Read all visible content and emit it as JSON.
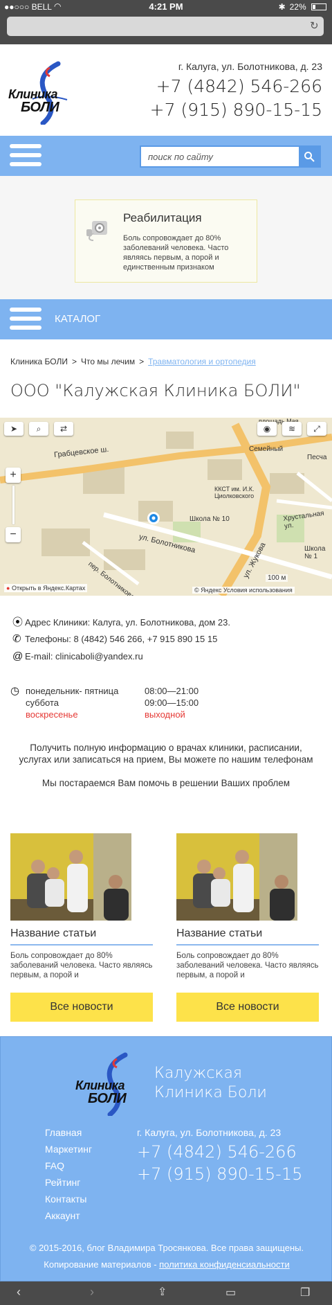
{
  "status_bar": {
    "carrier": "●●○○○ BELL",
    "time": "4:21 PM",
    "battery": "22%"
  },
  "header": {
    "logo_line1": "Клиника",
    "logo_line2": "БОЛИ",
    "address": "г. Калуга, ул. Болотникова, д. 23",
    "phone1": "+7 (4842) 546-266",
    "phone2": "+7 (915) 890-15-15"
  },
  "search": {
    "placeholder": "поиск по сайту"
  },
  "promo": {
    "title": "Реабилитация",
    "text": "Боль сопровождает до 80% заболеваний человека. Часто являясь первым, а порой и единственным признаком"
  },
  "catalog": {
    "label": "КАТАЛОГ"
  },
  "breadcrumb": {
    "items": [
      "Клиника БОЛИ",
      "Что мы лечим",
      "Травматология и ортопедия"
    ],
    "separator": ">"
  },
  "page_title": "ООО \"Калужская Клиника БОЛИ\"",
  "map": {
    "streets": [
      "Грабцевское ш.",
      "ул. Болотникова",
      "ул. Жукова",
      "пер. Болотникова",
      "Хрустальная ул.",
      "Песча",
      "площадь Мая"
    ],
    "pois": [
      "Семейный",
      "ККСТ им. И.К. Циолковского",
      "Школа № 10",
      "Школа № 1"
    ],
    "scale": "100 м",
    "open_link": "Открыть в Яндекс.Картах",
    "copyright": "© Яндекс Условия использования"
  },
  "contacts": {
    "address": "Адрес Клиники: Калуга, ул. Болотникова, дом 23.",
    "phones": "Телефоны: 8 (4842) 546 266, +7 915 890 15 15",
    "email": "E-mail: clinicaboli@yandex.ru"
  },
  "hours": [
    {
      "days": "понедельник- пятница",
      "time": "08:00—21:00"
    },
    {
      "days": "суббота",
      "time": "09:00—15:00"
    },
    {
      "days": "воскресенье",
      "time": "выходной"
    }
  ],
  "info_text": "Получить полную информацию о врачах клиники, расписании, услугах или записаться на прием, Вы можете по нашим телефонам",
  "help_text": "Мы постараемся Вам помочь в решении Ваших проблем",
  "articles": [
    {
      "title": "Название статьи",
      "text": "Боль сопровождает до 80% заболеваний человека. Часто являясь первым, а порой и",
      "button": "Все новости"
    },
    {
      "title": "Название статьи",
      "text": "Боль сопровождает до 80% заболеваний человека. Часто являясь первым, а порой и",
      "button": "Все новости"
    }
  ],
  "footer": {
    "logo_line1": "Клиника",
    "logo_line2": "БОЛИ",
    "brand_line1": "Калужская",
    "brand_line2": "Клиника Боли",
    "nav": [
      "Главная",
      "Маркетинг",
      "FAQ",
      "Рейтинг",
      "Контакты",
      "Аккаунт"
    ],
    "address": "г. Калуга, ул. Болотникова, д. 23",
    "phone1": "+7 (4842) 546-266",
    "phone2": "+7 (915) 890-15-15",
    "copyright": "© 2015-2016, блог Владимира Тросянкова. Все права защищены.",
    "copy_prefix": "Копирование материалов - ",
    "privacy_link": "политика конфиденсиальности"
  },
  "colors": {
    "accent_blue": "#7eb3f0",
    "button_yellow": "#fde24a",
    "weekend_red": "#e53935"
  }
}
